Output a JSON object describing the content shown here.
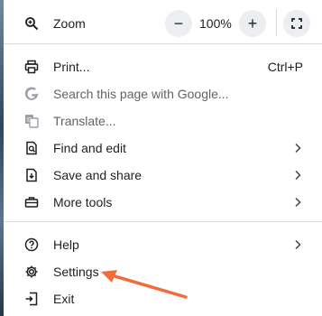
{
  "zoom": {
    "label": "Zoom",
    "minus": "−",
    "value": "100%",
    "plus": "+"
  },
  "items": [
    {
      "label": "Print...",
      "shortcut": "Ctrl+P"
    },
    {
      "label": "Search this page with Google..."
    },
    {
      "label": "Translate..."
    },
    {
      "label": "Find and edit"
    },
    {
      "label": "Save and share"
    },
    {
      "label": "More tools"
    },
    {
      "label": "Help"
    },
    {
      "label": "Settings"
    },
    {
      "label": "Exit"
    }
  ],
  "annotation": {
    "arrow_color": "#f26b3a"
  },
  "icons": [
    "zoom-icon",
    "fullscreen-icon",
    "print-icon",
    "google-g-icon",
    "translate-icon",
    "find-edit-icon",
    "save-share-icon",
    "toolbox-icon",
    "help-icon",
    "settings-gear-icon",
    "exit-icon",
    "chevron-right-icon"
  ]
}
